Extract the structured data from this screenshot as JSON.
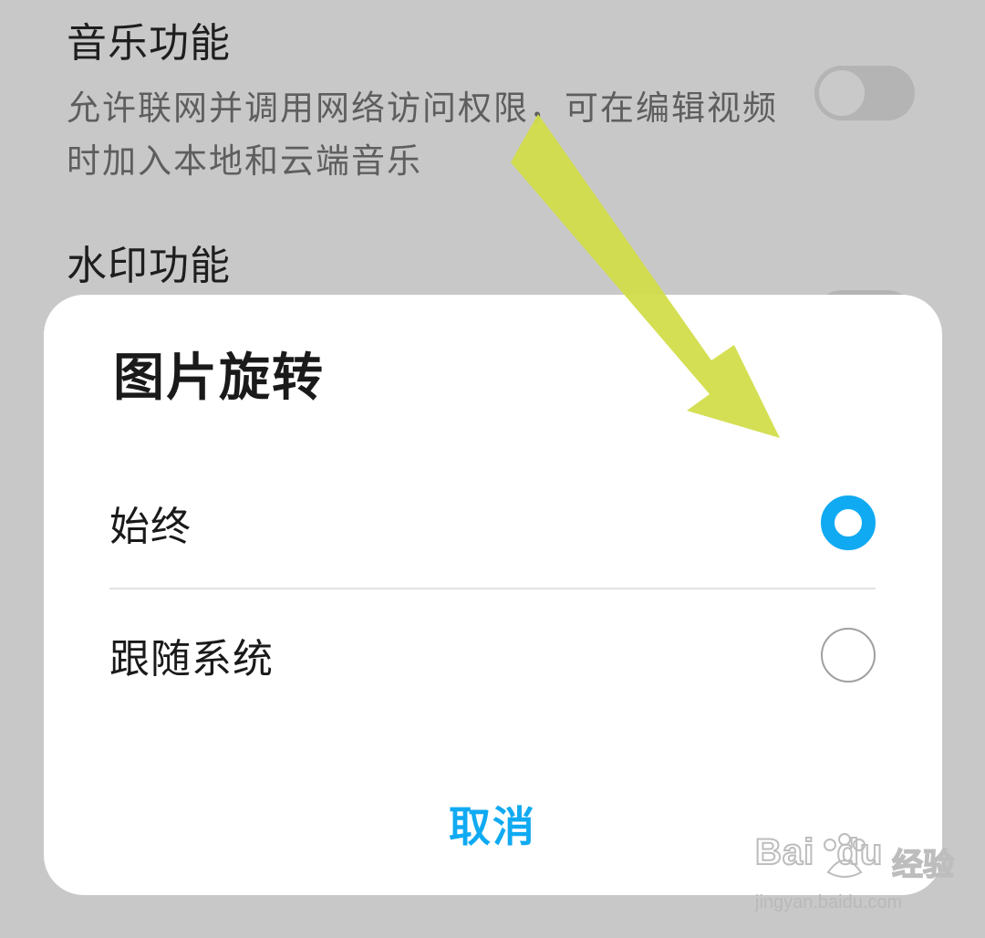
{
  "background_settings": {
    "music": {
      "title": "音乐功能",
      "description": "允许联网并调用网络访问权限，可在编辑视频时加入本地和云端音乐",
      "enabled": false
    },
    "watermark": {
      "title": "水印功能",
      "enabled": false
    }
  },
  "dialog": {
    "title": "图片旋转",
    "options": [
      {
        "label": "始终",
        "selected": true
      },
      {
        "label": "跟随系统",
        "selected": false
      }
    ],
    "cancel_label": "取消"
  },
  "colors": {
    "accent": "#10aaf2",
    "annotation_arrow": "#d2dd4a"
  },
  "overlay": {
    "watermark_logo": "Bai du 经验",
    "watermark_url": "jingyan.baidu.com"
  }
}
